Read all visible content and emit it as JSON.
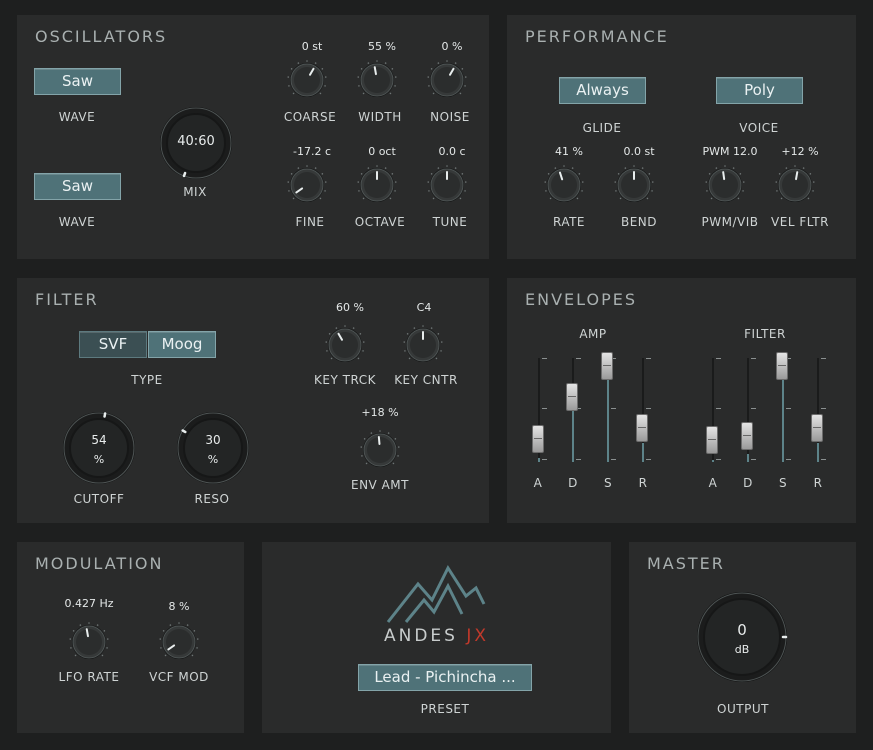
{
  "oscillators": {
    "title": "OSCILLATORS",
    "wave1": {
      "value": "Saw",
      "label": "WAVE"
    },
    "wave2": {
      "value": "Saw",
      "label": "WAVE"
    },
    "mix": {
      "value": "40:60",
      "label": "MIX"
    },
    "coarse": {
      "value": "0 st",
      "label": "COARSE"
    },
    "width": {
      "value": "55 %",
      "label": "WIDTH"
    },
    "noise": {
      "value": "0 %",
      "label": "NOISE"
    },
    "fine": {
      "value": "-17.2 c",
      "label": "FINE"
    },
    "octave": {
      "value": "0 oct",
      "label": "OCTAVE"
    },
    "tune": {
      "value": "0.0 c",
      "label": "TUNE"
    }
  },
  "performance": {
    "title": "PERFORMANCE",
    "glide": {
      "value": "Always",
      "label": "GLIDE"
    },
    "voice": {
      "value": "Poly",
      "label": "VOICE"
    },
    "rate": {
      "value": "41 %",
      "label": "RATE"
    },
    "bend": {
      "value": "0.0 st",
      "label": "BEND"
    },
    "pwm_vib": {
      "value": "PWM 12.0",
      "label": "PWM/VIB"
    },
    "vel_fltr": {
      "value": "+12 %",
      "label": "VEL FLTR"
    }
  },
  "filter": {
    "title": "FILTER",
    "type_options": [
      "SVF",
      "Moog"
    ],
    "type_selected": "Moog",
    "type_label": "TYPE",
    "key_trck": {
      "value": "60 %",
      "label": "KEY TRCK"
    },
    "key_cntr": {
      "value": "C4",
      "label": "KEY CNTR"
    },
    "env_amt": {
      "value": "+18 %",
      "label": "ENV AMT"
    },
    "cutoff": {
      "value": "54",
      "unit": "%",
      "label": "CUTOFF"
    },
    "reso": {
      "value": "30",
      "unit": "%",
      "label": "RESO"
    }
  },
  "envelopes": {
    "title": "ENVELOPES",
    "amp": {
      "label": "AMP",
      "a": 0.04,
      "d": 0.58,
      "s": 0.98,
      "r": 0.18
    },
    "filter": {
      "label": "FILTER",
      "a": 0.02,
      "d": 0.08,
      "s": 0.98,
      "r": 0.18
    },
    "slider_labels": [
      "A",
      "D",
      "S",
      "R"
    ]
  },
  "modulation": {
    "title": "MODULATION",
    "lfo_rate": {
      "value": "0.427 Hz",
      "label": "LFO RATE"
    },
    "vcf_mod": {
      "value": "8 %",
      "label": "VCF MOD"
    }
  },
  "brand": {
    "name": "ANDES",
    "suffix": "JX"
  },
  "preset": {
    "value": "Lead - Pichincha ...",
    "label": "PRESET"
  },
  "master": {
    "title": "MASTER",
    "output": {
      "value": "0",
      "unit": "dB",
      "label": "OUTPUT"
    }
  },
  "colors": {
    "accent": "#4f7278",
    "brand_suffix": "#c0392b",
    "logo": "#5d8389"
  }
}
